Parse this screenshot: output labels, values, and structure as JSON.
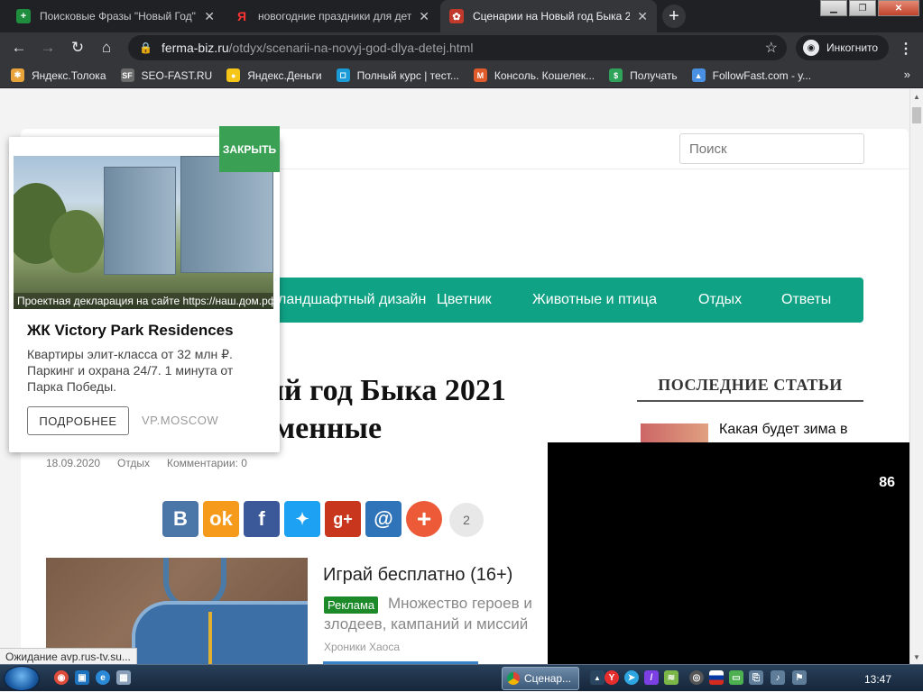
{
  "browser": {
    "tabs": [
      {
        "title": "Поисковые Фразы \"Новый Год\"",
        "favicon_color": "#1e8e3e",
        "favicon_glyph": "+"
      },
      {
        "title": "новогодние праздники для дете",
        "favicon_color": "#202124",
        "favicon_glyph": "Я",
        "favicon_text_color": "#ff3333"
      },
      {
        "title": "Сценарии на Новый год Быка 2",
        "favicon_color": "#c0392b",
        "favicon_glyph": "✿"
      }
    ],
    "url_host": "ferma-biz.ru",
    "url_path": "/otdyx/scenarii-na-novyj-god-dlya-detej.html",
    "incognito_label": "Инкогнито",
    "bookmarks": [
      {
        "label": "Яндекс.Толока",
        "color": "#e8a33b",
        "glyph": "✱"
      },
      {
        "label": "SEO-FAST.RU",
        "color": "#6b6b6b",
        "glyph": "SF"
      },
      {
        "label": "Яндекс.Деньги",
        "color": "#f5c518",
        "glyph": "●"
      },
      {
        "label": "Полный курс | тест...",
        "color": "#1a9bd7",
        "glyph": "◻"
      },
      {
        "label": "Консоль. Кошелек...",
        "color": "#e05a2a",
        "glyph": "M"
      },
      {
        "label": "Получать",
        "color": "#2fa35a",
        "glyph": "$"
      },
      {
        "label": "FollowFast.com - у...",
        "color": "#4a90e2",
        "glyph": "👍"
      }
    ]
  },
  "page": {
    "search_placeholder": "Поиск",
    "nav": [
      "ландшафтный дизайн",
      "Цветник",
      "Животные и птица",
      "Отдых",
      "Ответы"
    ],
    "title_line1": "вый год Быка 2021",
    "title_line2": "ременные",
    "meta": {
      "date": "18.09.2020",
      "category": "Отдых",
      "comments": "Комментарии: 0"
    },
    "sidebar_title": "ПОСЛЕДНИЕ СТАТЬИ",
    "sidebar_first_link": "Какая будет зима в",
    "share_count": "2",
    "ad": {
      "title": "Играй бесплатно (16+)",
      "badge": "Реклама",
      "text1": "Множество героев и",
      "text2": "злодеев, кампаний и миссий",
      "source": "Хроники Хаоса"
    }
  },
  "popup": {
    "close_label": "ЗАКРЫТЬ",
    "caption": "Проектная декларация на сайте https://наш.дом.рф",
    "title": "ЖК Victory Park Residences",
    "description": "Квартиры элит-класса от 32 млн ₽. Паркинг и охрана 24/7. 1 минута от Парка Победы.",
    "more_label": "ПОДРОБНЕЕ",
    "domain": "VP.MOSCOW"
  },
  "video": {
    "counter": "86"
  },
  "status_text": "Ожидание avp.rus-tv.su...",
  "taskbar": {
    "task_label": "Сценар...",
    "clock": "13:47"
  }
}
